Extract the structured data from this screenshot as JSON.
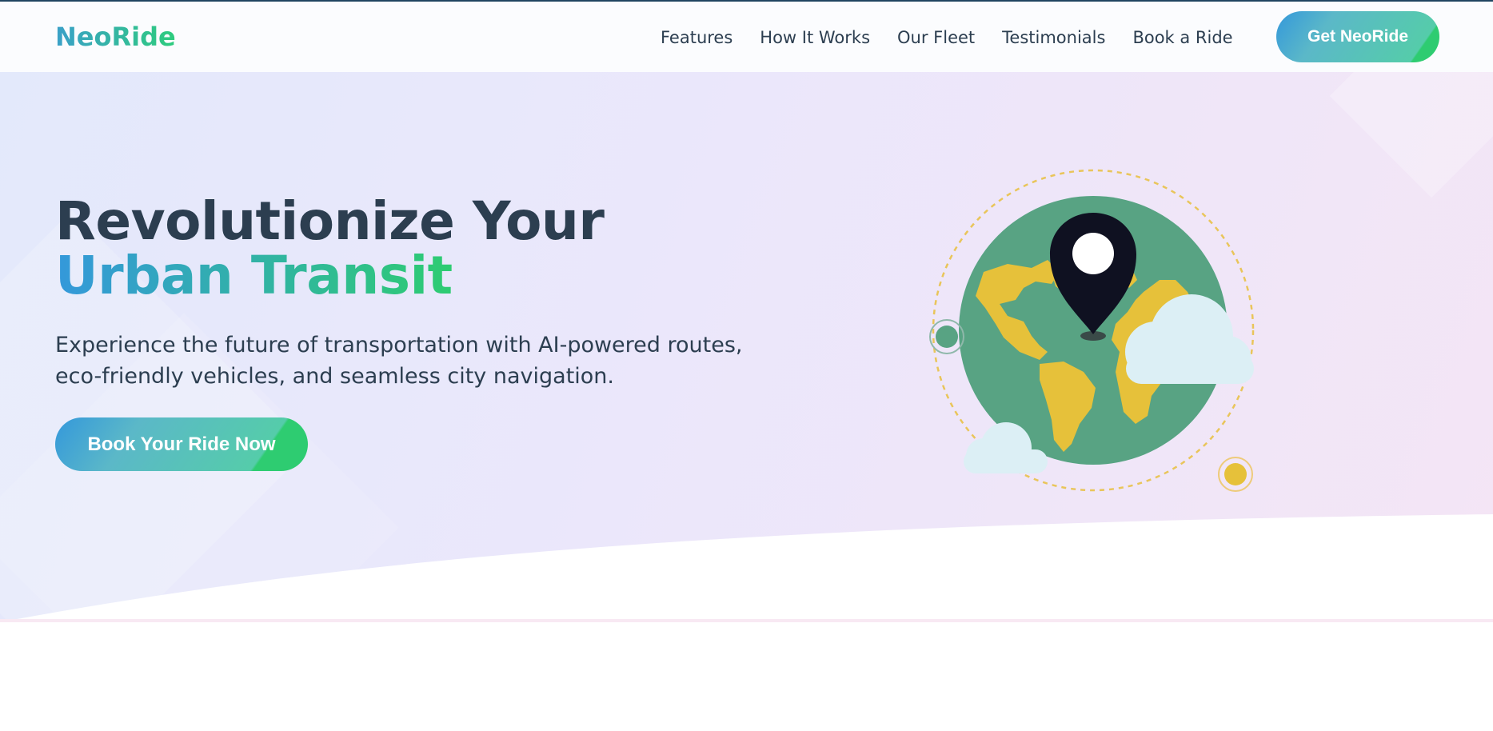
{
  "brand": {
    "name": "NeoRide"
  },
  "nav": {
    "links": [
      "Features",
      "How It Works",
      "Our Fleet",
      "Testimonials",
      "Book a Ride"
    ],
    "cta_label": "Get NeoRide"
  },
  "hero": {
    "headline_part1": "Revolutionize Your ",
    "headline_part2": "Urban Transit",
    "subtext": "Experience the future of transportation with AI-powered routes, eco-friendly vehicles, and seamless city navigation.",
    "cta_label": "Book Your Ride Now"
  },
  "colors": {
    "text_dark": "#2c3e50",
    "accent_blue": "#3498db",
    "accent_green": "#2ecc71",
    "globe_green": "#58a383",
    "land_yellow": "#e6c13a",
    "pin_dark": "#0f1121",
    "cloud": "#dceff5"
  },
  "icons": {
    "hero_illustration": "globe-with-location-pin"
  }
}
